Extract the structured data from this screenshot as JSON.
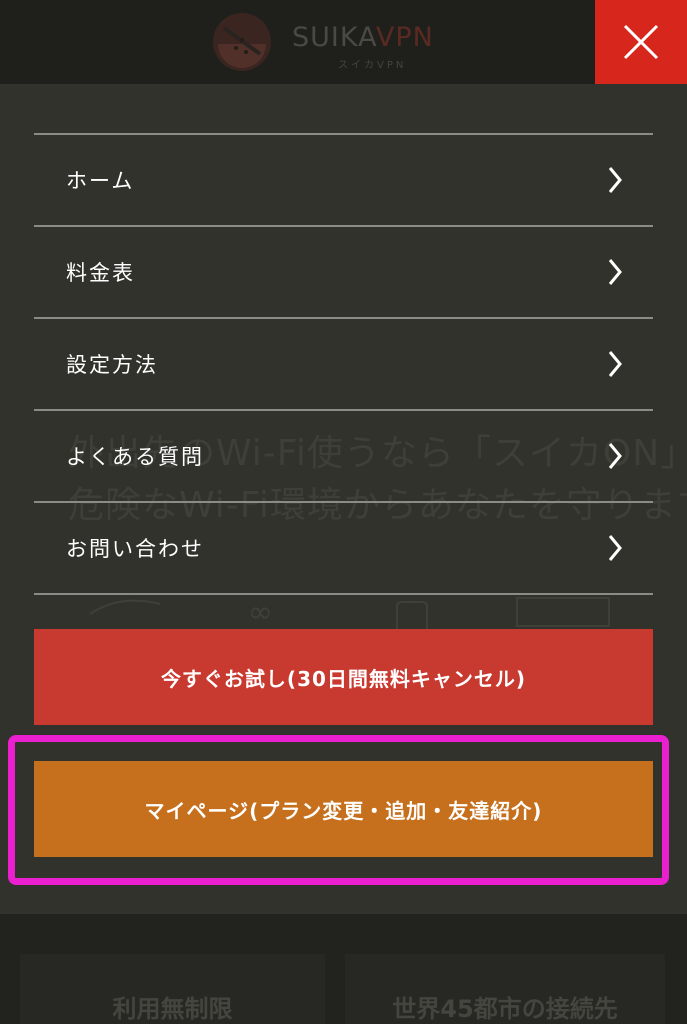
{
  "header": {
    "logo_text_main": "SUIKA",
    "logo_text_vpn": "VPN",
    "logo_subtext": "スイカVPN",
    "close_icon": "close-icon"
  },
  "background": {
    "headline_line1": "外出先のWi-Fi使うなら「スイカON」",
    "headline_line2": "危険なWi-Fi環境からあなたを守ります"
  },
  "menu": {
    "items": [
      {
        "label": "ホーム",
        "icon": "chevron-right-icon"
      },
      {
        "label": "料金表",
        "icon": "chevron-right-icon"
      },
      {
        "label": "設定方法",
        "icon": "chevron-right-icon"
      },
      {
        "label": "よくある質問",
        "icon": "chevron-right-icon"
      },
      {
        "label": "お問い合わせ",
        "icon": "chevron-right-icon"
      }
    ]
  },
  "cta": {
    "trial_label": "今すぐお試し(30日間無料キャンセル)",
    "mypage_label": "マイページ(プラン変更・追加・友達紹介)"
  },
  "bottom": {
    "left_card": "利用無制限",
    "right_card": "世界45都市の接続先"
  },
  "colors": {
    "close": "#d7261c",
    "trial": "#c8392f",
    "mypage": "#c66f1c",
    "highlight": "#ea1fd0"
  }
}
